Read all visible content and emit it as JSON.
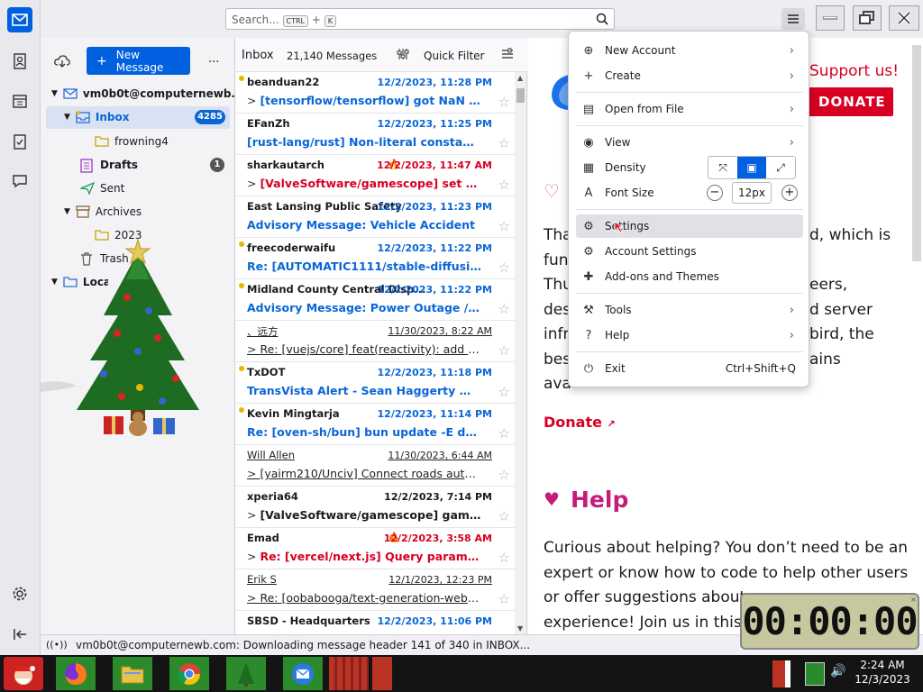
{
  "search": {
    "placeholder": "Search...",
    "kbd1": "CTRL",
    "plus": "+",
    "kbd2": "K"
  },
  "toolbar": {
    "new_message": "New Message",
    "more": "..."
  },
  "account": {
    "name": "vm0b0t@computernewb...",
    "folders": [
      {
        "name": "Inbox",
        "badge": "4285"
      },
      {
        "name": "frowning4"
      },
      {
        "name": "Drafts",
        "badge": "1"
      },
      {
        "name": "Sent"
      },
      {
        "name": "Archives"
      },
      {
        "name": "2023"
      },
      {
        "name": "Trash"
      }
    ],
    "local_folders": "Local Folders"
  },
  "thread": {
    "folder": "Inbox",
    "count": "21,140 Messages",
    "quick_filter": "Quick Filter",
    "rows": [
      {
        "sender": "beanduan22",
        "date": "12/2/2023, 11:28 PM",
        "subject": "[tensorflow/tensorflow] got NaN wh...",
        "style": "unread",
        "color": "blue",
        "dot": true,
        "thread": true,
        "fire": false
      },
      {
        "sender": "EFanZh",
        "date": "12/2/2023, 11:25 PM",
        "subject": "[rust-lang/rust] Non-literal constant obj...",
        "style": "unread",
        "color": "blue",
        "dot": false,
        "thread": false,
        "fire": false
      },
      {
        "sender": "sharkautarch",
        "date": "12/2/2023, 11:47 AM",
        "subject": "[ValveSoftware/gamescope] set global d...",
        "style": "unread",
        "color": "red",
        "dot": false,
        "thread": true,
        "fire": true
      },
      {
        "sender": "East Lansing Public Safety",
        "date": "12/2/2023, 11:23 PM",
        "subject": "Advisory Message: Vehicle Accident",
        "style": "unread",
        "color": "blue",
        "dot": false,
        "thread": false,
        "fire": false
      },
      {
        "sender": "freecoderwaifu",
        "date": "12/2/2023, 11:22 PM",
        "subject": "Re: [AUTOMATIC1111/stable-diffusion-...",
        "style": "unread",
        "color": "blue",
        "dot": true,
        "thread": false,
        "fire": false
      },
      {
        "sender": "Midland County Central Disp...",
        "date": "12/2/2023, 11:22 PM",
        "subject": "Advisory Message: Power Outage // M2...",
        "style": "unread",
        "color": "blue",
        "dot": true,
        "thread": false,
        "fire": false
      },
      {
        "sender": "、远方",
        "date": "11/30/2023, 8:22 AM",
        "subject": "Re: [vuejs/core] feat(reactivity): add `pau...",
        "style": "read",
        "color": "",
        "dot": false,
        "thread": true,
        "fire": false
      },
      {
        "sender": "TxDOT",
        "date": "12/2/2023, 11:18 PM",
        "subject": "TransVista Alert - Sean Haggerty @ Gat...",
        "style": "unread",
        "color": "blue",
        "dot": true,
        "thread": false,
        "fire": false
      },
      {
        "sender": "Kevin Mingtarja",
        "date": "12/2/2023, 11:14 PM",
        "subject": "Re: [oven-sh/bun] bun update -E doesn'...",
        "style": "unread",
        "color": "blue",
        "dot": true,
        "thread": false,
        "fire": false
      },
      {
        "sender": "Will Allen",
        "date": "11/30/2023, 6:44 AM",
        "subject": "[yairm210/Unciv] Connect roads automa...",
        "style": "read",
        "color": "",
        "dot": false,
        "thread": true,
        "fire": false
      },
      {
        "sender": "xperia64",
        "date": "12/2/2023, 7:14 PM",
        "subject": "[ValveSoftware/gamescope] gamesco...",
        "style": "unread",
        "color": "",
        "dot": false,
        "thread": true,
        "fire": false
      },
      {
        "sender": "Emad",
        "date": "12/2/2023, 3:58 AM",
        "subject": "Re: [vercel/next.js] Query params in Nex...",
        "style": "unread",
        "color": "red",
        "dot": false,
        "thread": true,
        "fire": true
      },
      {
        "sender": "Erik S",
        "date": "12/1/2023, 12:23 PM",
        "subject": "Re: [oobabooga/text-generation-webui]...",
        "style": "read",
        "color": "",
        "dot": false,
        "thread": true,
        "fire": false
      },
      {
        "sender": "SBSD - Headquarters",
        "date": "12/2/2023, 11:06 PM",
        "subject": "",
        "style": "unread",
        "color": "blue",
        "dot": false,
        "thread": false,
        "fire": false
      }
    ]
  },
  "message": {
    "support": "Support us!",
    "donate_btn": "DONATE",
    "para1": [
      "Tha",
      "fun",
      "Thu",
      "des",
      "infr",
      "bes",
      "ava"
    ],
    "para1_right": [
      "d, which is",
      "",
      "eers,",
      "d server",
      "bird, the",
      "ains",
      ""
    ],
    "donate_link": "Donate",
    "help_title": "Help",
    "help_lines": [
      "Curious about helping? You don’t need to be an",
      "expert or know how to code to help other users",
      "or offer suggestions about",
      "experience! Join us in this c"
    ]
  },
  "menu": {
    "items": [
      {
        "label": "New Account",
        "icon": "⊕",
        "arrow": true
      },
      {
        "label": "Create",
        "icon": "+",
        "arrow": true
      },
      {
        "label": "Open from File",
        "icon": "▤",
        "arrow": true
      },
      {
        "label": "View",
        "icon": "◉",
        "arrow": true
      },
      {
        "label": "Density",
        "icon": "▦",
        "arrow": false
      },
      {
        "label": "Font Size",
        "icon": "A",
        "arrow": false,
        "value": "12px"
      },
      {
        "label": "Settings",
        "icon": "⚙",
        "arrow": false
      },
      {
        "label": "Account Settings",
        "icon": "⚙",
        "arrow": false
      },
      {
        "label": "Add-ons and Themes",
        "icon": "✚",
        "arrow": false
      },
      {
        "label": "Tools",
        "icon": "🔧",
        "arrow": true
      },
      {
        "label": "Help",
        "icon": "?",
        "arrow": true
      },
      {
        "label": "Exit",
        "icon": "⏻",
        "arrow": false,
        "shortcut": "Ctrl+Shift+Q"
      }
    ]
  },
  "status": {
    "text": "vm0b0t@computernewb.com: Downloading message header 141 of 340 in INBOX..."
  },
  "timer": {
    "value": "00:00:00"
  },
  "clock": {
    "time": "2:24 AM",
    "date": "12/3/2023"
  },
  "colors": {
    "accent": "#0060df",
    "donate_red": "#d70022",
    "help_pink": "#c51c7a",
    "taskbar_green": "#2b8a2b"
  }
}
